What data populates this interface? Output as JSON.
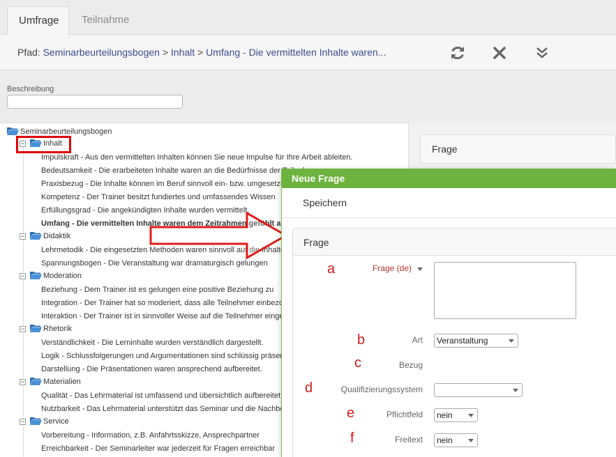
{
  "tabs": [
    {
      "label": "Umfrage",
      "active": true
    },
    {
      "label": "Teilnahme",
      "active": false
    }
  ],
  "path": {
    "prefix": "Pfad:",
    "crumbs": [
      "Seminarbeurteilungsbogen",
      "Inhalt",
      "Umfang - Die vermittelten Inhalte waren..."
    ],
    "separator": " > "
  },
  "toolbar": {
    "icons": [
      "refresh-icon",
      "close-icon",
      "chevron-double-down-icon"
    ]
  },
  "description": {
    "label": "Beschreibung",
    "value": ""
  },
  "tree": {
    "root": "Seminarbeurteilungsbogen",
    "categories": [
      {
        "label": "Inhalt",
        "items": [
          "Impulskraft - Aus den vermittelten Inhalten können Sie neue Impulse für Ihre Arbeit ableiten.",
          "Bedeutsamkeit - Die erarbeiteten Inhalte waren an die Bedürfnisse der Teilnehmer",
          "Praxisbezug - Die Inhalte können im Beruf sinnvoll ein- bzw. umgesetzt werden.",
          "Kompetenz - Der Trainer besitzt fundiertes und umfassendes Wissen",
          "Erfüllungsgrad - Die angekündigten Inhalte wurden vermittelt.",
          "Umfang - Die vermittelten Inhalte waren dem Zeitrahmen gefühlt angemessen."
        ]
      },
      {
        "label": "Didaktik",
        "items": [
          "Lehrmetodik - Die eingesetzten Methoden waren sinnvoll auf die Inhalte abgestimmt.",
          "Spannungsbogen - Die Veranstaltung war dramaturgisch gelungen"
        ]
      },
      {
        "label": "Moderation",
        "items": [
          "Beziehung - Dem Trainer ist es gelungen eine positive Beziehung zu",
          "Integration - Der Trainer hat so moderiert, dass alle Teilnehmer einbezogen",
          "Interaktion - Der Trainer ist in sinnvoller Weise auf die Teilnehmer eingegangen"
        ]
      },
      {
        "label": "Rhetorik",
        "items": [
          "Verständlichkeit - Die Lerninhalte wurden verständlich dargestellt.",
          "Logik - Schlussfolgerungen und Argumentationen sind schlüssig präsentiert.",
          "Darstellung - Die Präsentationen waren ansprechend aufbereitet."
        ]
      },
      {
        "label": "Materialien",
        "items": [
          "Qualität - Das Lehrmaterial ist umfassend und übersichtlich aufbereitet.",
          "Nutzbarkeit - Das Lehrmaterial unterstützt das Seminar und die Nachbereitung"
        ]
      },
      {
        "label": "Service",
        "items": [
          "Vorbereitung - Information, z.B. Anfahrtsskizze, Ansprechpartner",
          "Erreichbarkeit - Der Seminarleiter war jederzeit für Fragen erreichbar"
        ]
      }
    ]
  },
  "right_panel": {
    "card_title": "Frage"
  },
  "dialog": {
    "title": "Neue Frage",
    "save_label": "Speichern",
    "section_title": "Frage",
    "fields": {
      "frage": {
        "letter": "a",
        "label": "Frage (de)",
        "value": ""
      },
      "art": {
        "letter": "b",
        "label": "Art",
        "value": "Veranstaltung"
      },
      "bezug": {
        "letter": "c",
        "label": "Bezug"
      },
      "qualifizierungssystem": {
        "letter": "d",
        "label": "Qualifizierungssystem",
        "value": ""
      },
      "pflichtfeld": {
        "letter": "e",
        "label": "Pflichtfeld",
        "value": "nein"
      },
      "freitext": {
        "letter": "f",
        "label": "Freitext",
        "value": "nein"
      }
    }
  },
  "colors": {
    "dialog_header": "#6db33f",
    "link": "#3d4c8c",
    "annotation": "#d01c1c",
    "folder": "#3b7fc4"
  }
}
